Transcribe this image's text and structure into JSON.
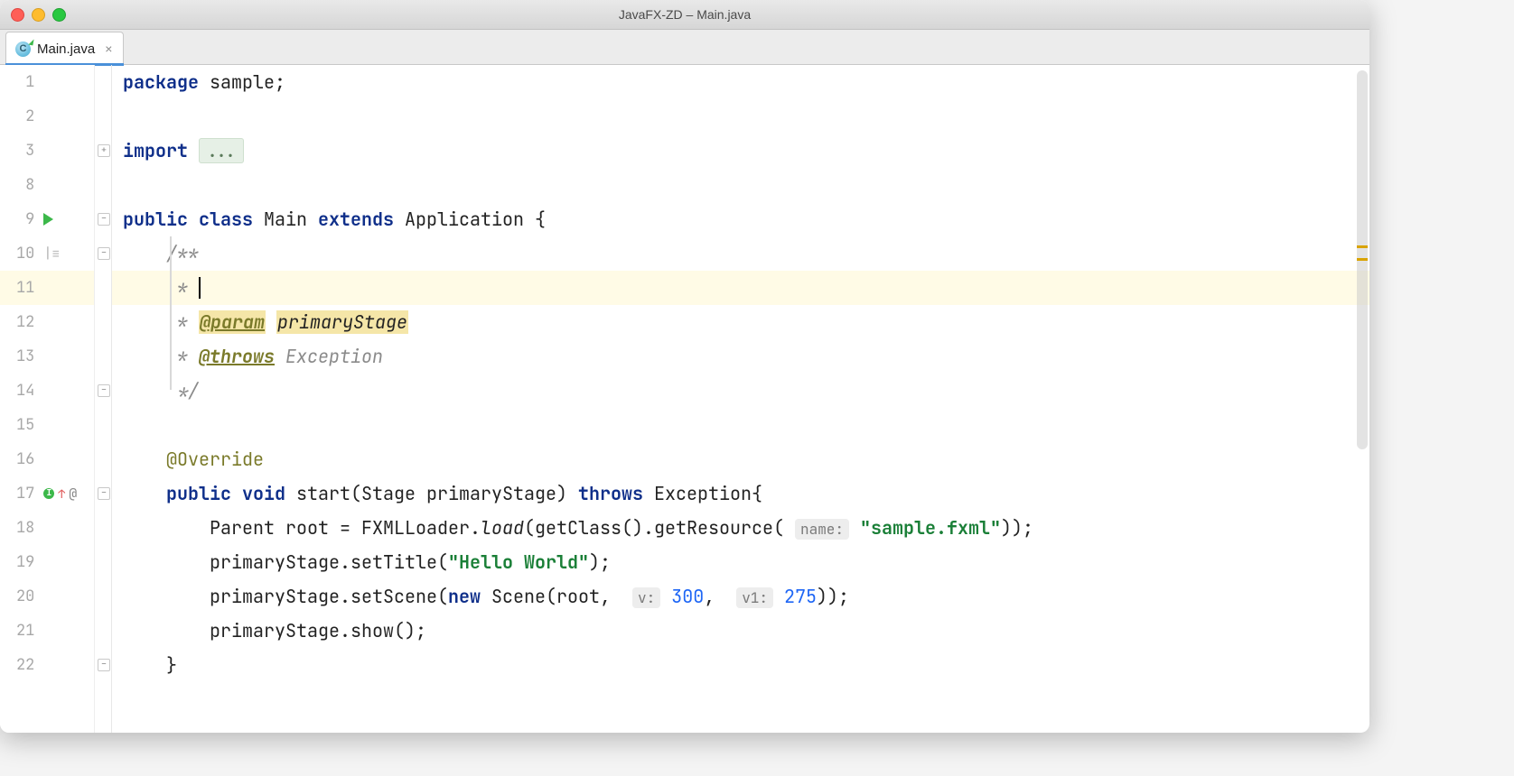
{
  "window": {
    "title": "JavaFX-ZD – Main.java"
  },
  "tab": {
    "label": "Main.java",
    "icon_letter": "C"
  },
  "gutter": {
    "lines": [
      "1",
      "2",
      "3",
      "8",
      "9",
      "10",
      "11",
      "12",
      "13",
      "14",
      "15",
      "16",
      "17",
      "18",
      "19",
      "20",
      "21",
      "22"
    ]
  },
  "code": {
    "package_kw": "package",
    "package_name": " sample;",
    "import_kw": "import",
    "import_fold": "...",
    "class_decl_1": "public",
    "class_decl_2": "class",
    "class_name": " Main ",
    "class_decl_3": "extends",
    "class_super": " Application {",
    "jd_open": "/**",
    "jd_star": " * ",
    "jd_param_tag": "@param",
    "jd_param_name": "primaryStage",
    "jd_throws_tag": "@throws",
    "jd_throws_name": " Exception",
    "jd_close": " */",
    "override": "@Override",
    "m_public": "public",
    "m_void": "void",
    "m_sig1": " start(Stage primaryStage) ",
    "m_throws": "throws",
    "m_sig2": " Exception{",
    "l18a": "Parent root = FXMLLoader.",
    "l18b": "load",
    "l18c": "(getClass().getResource(",
    "hint_name": "name:",
    "l18d": "\"sample.fxml\"",
    "l18e": "));",
    "l19a": "primaryStage.setTitle(",
    "l19b": "\"Hello World\"",
    "l19c": ");",
    "l20a": "primaryStage.setScene(",
    "l20_new": "new",
    "l20b": " Scene(root, ",
    "hint_v": "v:",
    "l20_n1": "300",
    "l20c": ", ",
    "hint_v1": "v1:",
    "l20_n2": "275",
    "l20d": "));",
    "l21": "primaryStage.show();",
    "l22": "}"
  }
}
